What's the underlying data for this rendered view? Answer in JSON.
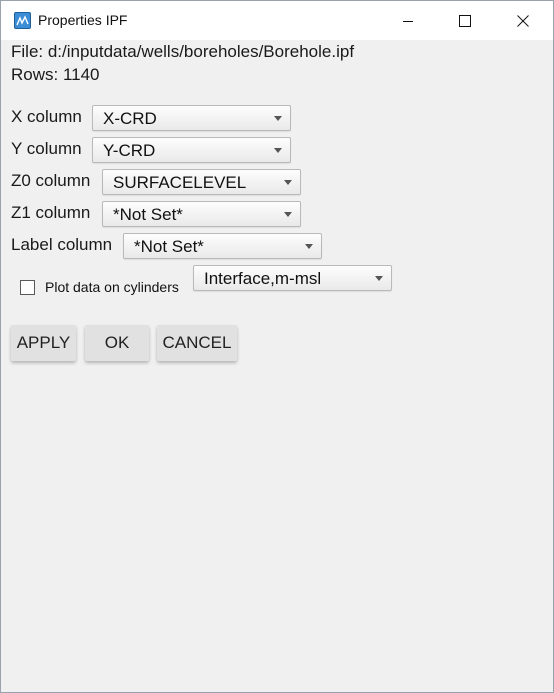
{
  "window": {
    "title": "Properties IPF",
    "app_icon": "ipf-app-icon",
    "controls": [
      "minimize-icon",
      "maximize-icon",
      "close-icon"
    ]
  },
  "file_info": {
    "file": "File: d:/inputdata/wells/boreholes/Borehole.ipf",
    "rows": "Rows: 1140"
  },
  "fields": {
    "x_column": {
      "label": "X column",
      "value": "X-CRD"
    },
    "y_column": {
      "label": "Y column",
      "value": "Y-CRD"
    },
    "z0_column": {
      "label": "Z0 column",
      "value": "SURFACELEVEL"
    },
    "z1_column": {
      "label": "Z1 column",
      "value": "*Not Set*"
    },
    "label_column": {
      "label": "Label column",
      "value": "*Not Set*"
    }
  },
  "cylinders": {
    "checkbox_label": "Plot data on cylinders",
    "checked": false,
    "select_value": "Interface,m-msl"
  },
  "buttons": {
    "apply": "APPLY",
    "ok": "OK",
    "cancel": "CANCEL"
  }
}
